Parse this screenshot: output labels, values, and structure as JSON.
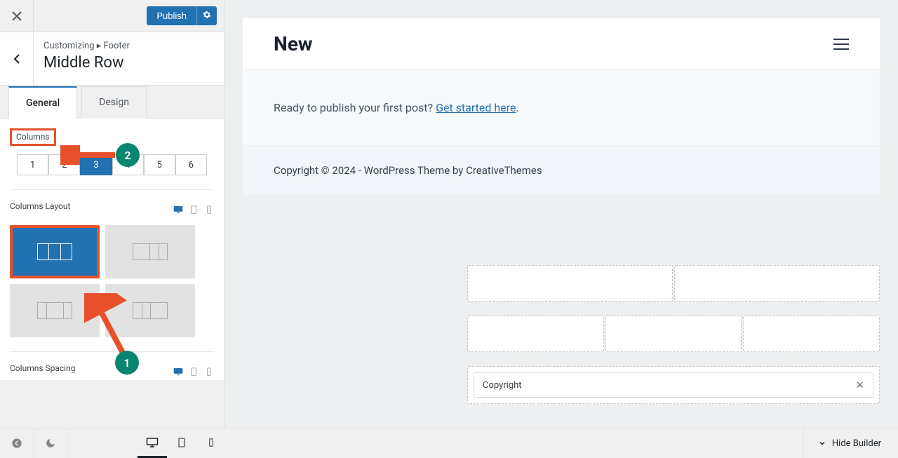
{
  "top": {
    "publish": "Publish"
  },
  "breadcrumb": {
    "lead": "Customizing ▸ Footer",
    "title": "Middle Row"
  },
  "tabs": {
    "general": "General",
    "design": "Design"
  },
  "columns": {
    "label": "Columns",
    "choices": [
      "1",
      "2",
      "3",
      "4",
      "5",
      "6"
    ],
    "selected": "3"
  },
  "layout": {
    "label": "Columns Layout"
  },
  "spacing": {
    "label": "Columns Spacing"
  },
  "bottom": {
    "hide": "Hide Builder"
  },
  "preview": {
    "title": "New",
    "body_pre": "Ready to publish your first post? ",
    "body_link": "Get started here",
    "footer": "Copyright © 2024 - WordPress Theme by CreativeThemes"
  },
  "builder": {
    "copyright_label": "Copyright"
  },
  "annot": {
    "b1": "1",
    "b2": "2"
  }
}
